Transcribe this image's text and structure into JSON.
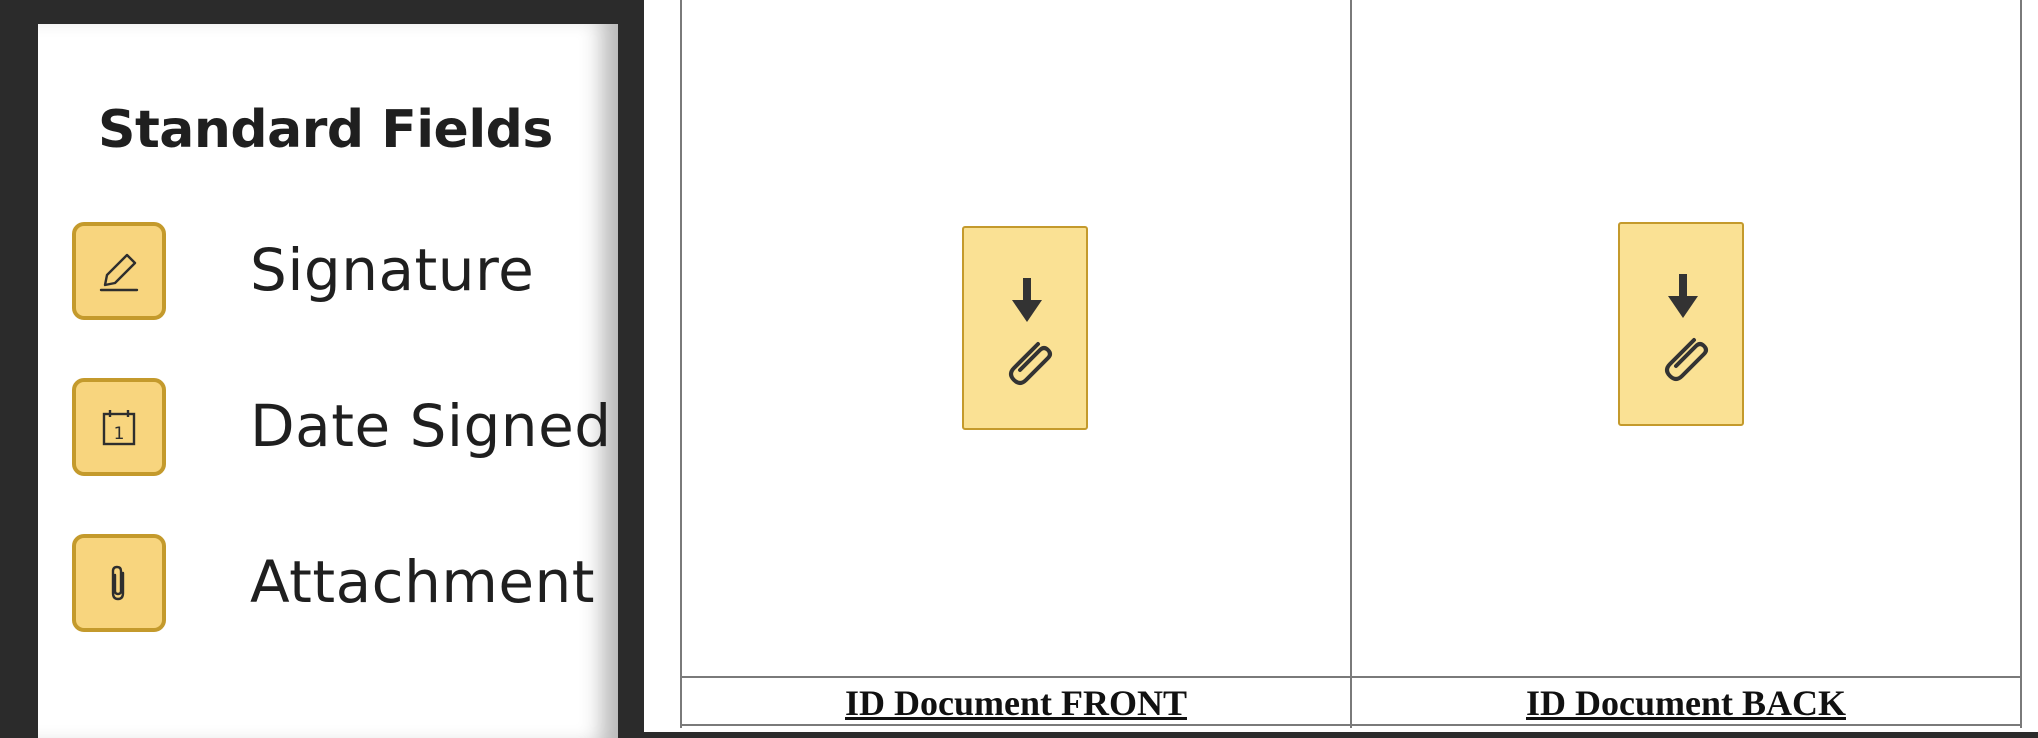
{
  "panel": {
    "title": "Standard Fields",
    "fields": [
      {
        "label": "Signature",
        "icon": "pen-icon"
      },
      {
        "label": "Date Signed",
        "icon": "calendar-icon",
        "icon_text": "1"
      },
      {
        "label": "Attachment",
        "icon": "paperclip-icon"
      }
    ]
  },
  "document": {
    "captions": [
      "ID Document FRONT",
      "ID Document BACK"
    ],
    "attachment_fields": [
      {
        "icon": "download-attachment-icon"
      },
      {
        "icon": "download-attachment-icon"
      }
    ]
  },
  "colors": {
    "field_fill": "#f8d57e",
    "field_border": "#c49a2c",
    "attachment_fill": "#fae194",
    "background_dark": "#2b2b2b"
  }
}
